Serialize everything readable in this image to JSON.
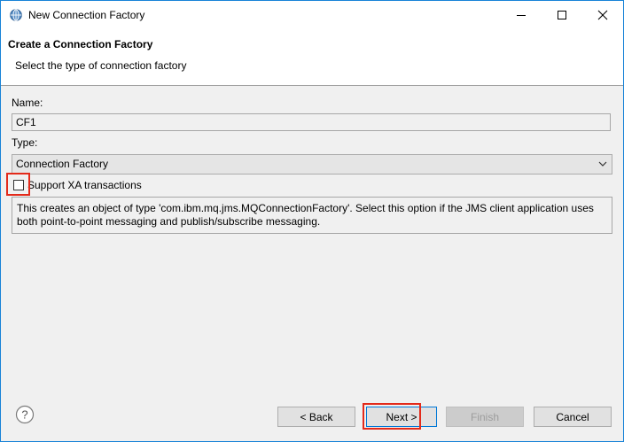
{
  "window": {
    "title": "New Connection Factory",
    "controls": {
      "minimize": "minimize-icon",
      "maximize": "maximize-icon",
      "close": "close-icon"
    }
  },
  "banner": {
    "title": "Create a Connection Factory",
    "subtitle": "Select the type of connection factory"
  },
  "form": {
    "name_label": "Name:",
    "name_value": "CF1",
    "type_label": "Type:",
    "type_value": "Connection Factory",
    "xa_label": "Support XA transactions",
    "xa_checked": false,
    "description": "This creates an object of type 'com.ibm.mq.jms.MQConnectionFactory'. Select this option if the JMS client application uses both point-to-point messaging and publish/subscribe messaging."
  },
  "buttons": {
    "back": "< Back",
    "next": "Next >",
    "finish": "Finish",
    "cancel": "Cancel"
  },
  "colors": {
    "highlight": "#e32a1a",
    "focus": "#0078d7"
  }
}
